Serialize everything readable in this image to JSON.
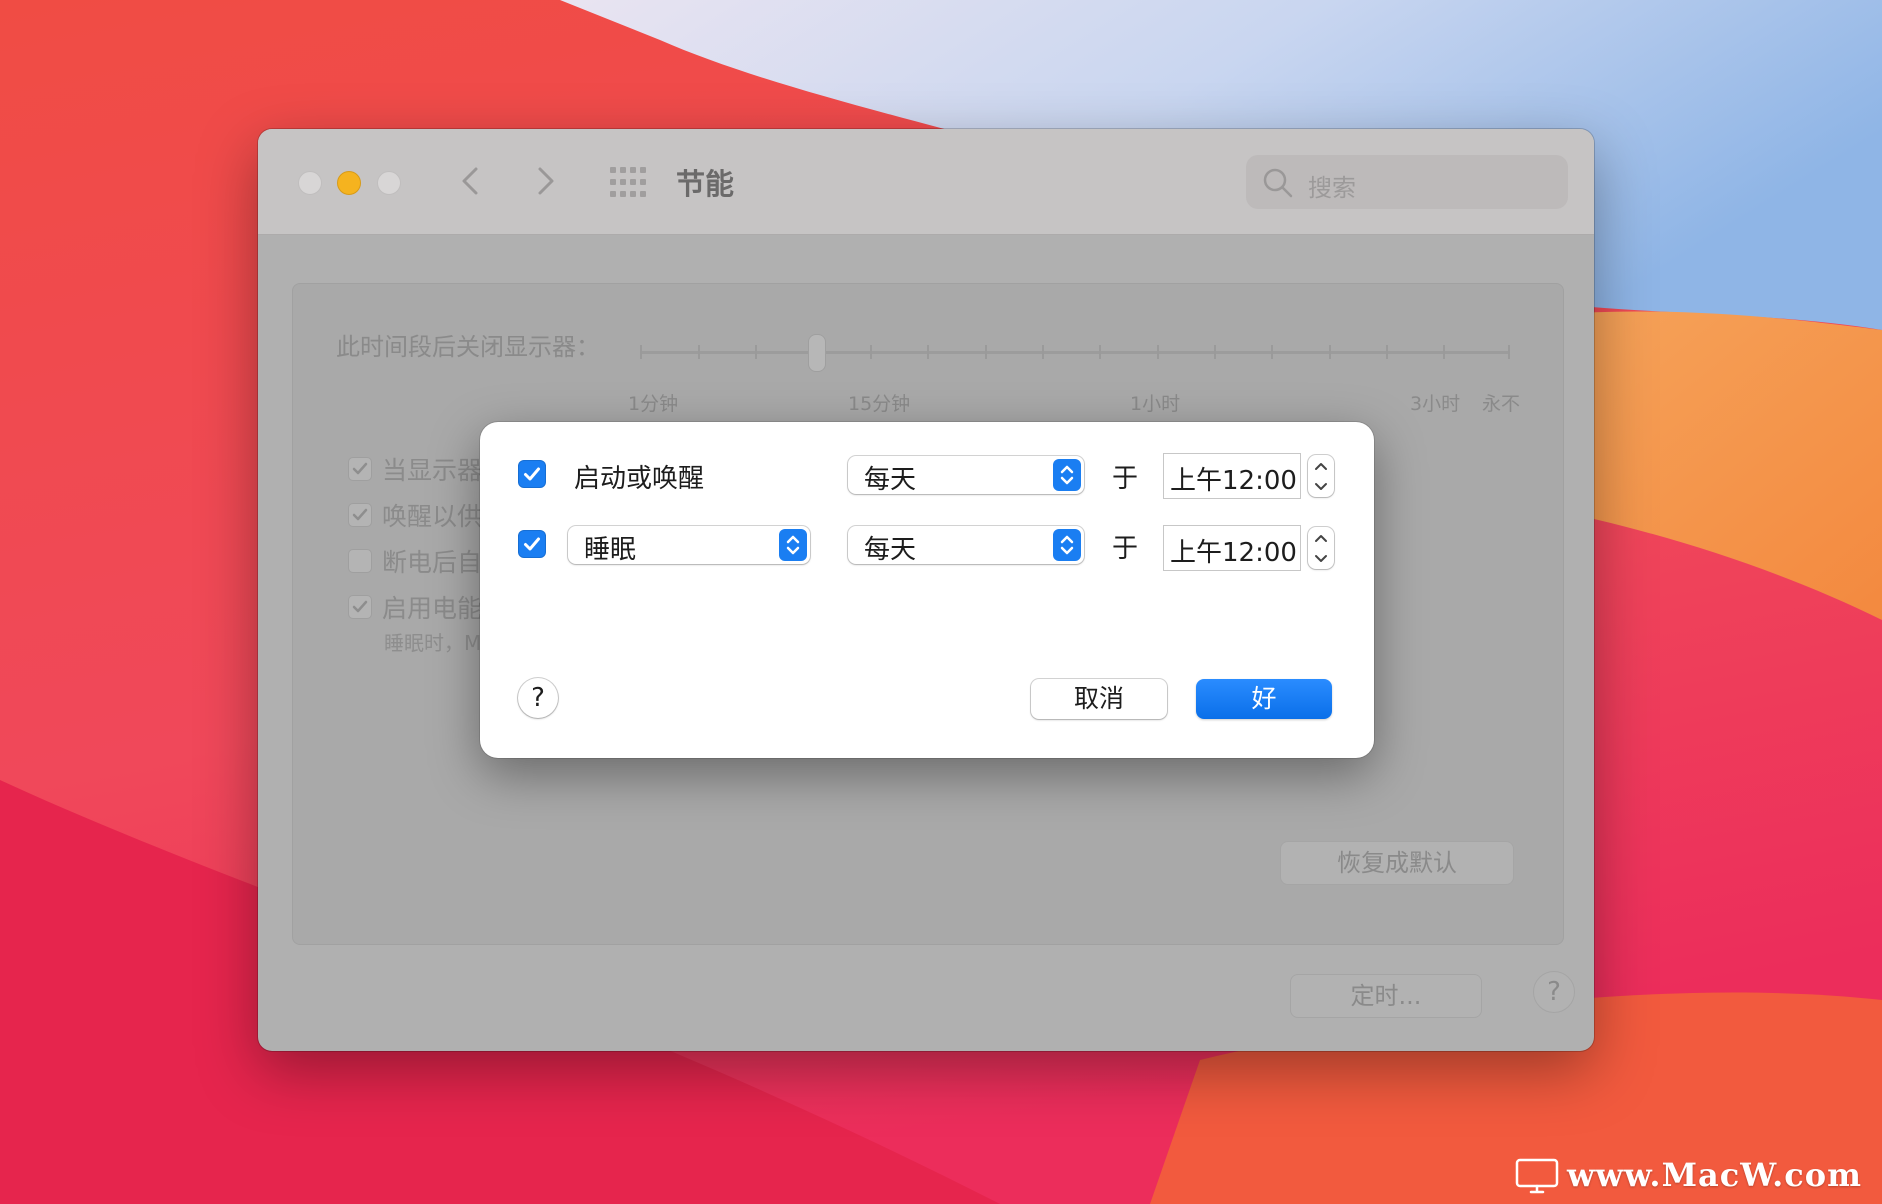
{
  "window": {
    "title": "节能",
    "search_placeholder": "搜索"
  },
  "display_sleep": {
    "label": "此时间段后关闭显示器：",
    "tick_labels": [
      "1分钟",
      "15分钟",
      "1小时",
      "3小时",
      "永不"
    ]
  },
  "options": [
    {
      "label": "当显示器",
      "checked": true
    },
    {
      "label": "唤醒以供",
      "checked": true
    },
    {
      "label": "断电后自",
      "checked": false
    },
    {
      "label": "启用电能",
      "checked": true
    }
  ],
  "options_note": "睡眠时，M",
  "buttons": {
    "restore_defaults": "恢复成默认",
    "schedule": "定时...",
    "help": "?"
  },
  "schedule_sheet": {
    "rows": [
      {
        "checked": true,
        "action_label": "启动或唤醒",
        "frequency": "每天",
        "at_label": "于",
        "time": "上午12:00"
      },
      {
        "checked": true,
        "action": "睡眠",
        "frequency": "每天",
        "at_label": "于",
        "time": "上午12:00"
      }
    ],
    "help": "?",
    "cancel_label": "取消",
    "ok_label": "好"
  },
  "watermark": "www.MacW.com"
}
